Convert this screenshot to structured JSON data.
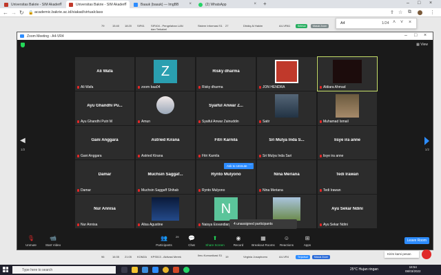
{
  "browser": {
    "tabs": [
      {
        "title": "Universitas Bakrie - SIM Akadem",
        "active": false,
        "color": "#c0392b"
      },
      {
        "title": "Universitas Bakrie - SIM Akadem",
        "active": true,
        "color": "#c0392b"
      },
      {
        "title": "Baauk (baauk) — ImgBB",
        "active": false,
        "color": "#2d8cff"
      },
      {
        "title": "(2) WhatsApp",
        "active": false,
        "color": "#25d366"
      }
    ],
    "url": "academic.bakrie.ac.id/siakad/virtualclass",
    "find": {
      "query": "A4",
      "count": "1/24"
    }
  },
  "bg_table": {
    "top_row": [
      "79",
      "15:40",
      "18:20",
      "SIF61",
      "SIF404 - Pengelahan LAN dan Terkabel",
      "Sistem Informasi S1",
      "27",
      "Dhidiq Al Hakim",
      "A4-VR61",
      "Selesai",
      "Masuk Zoom"
    ],
    "bottom_row": [
      "96",
      "16:35",
      "21:05",
      "KOM2A",
      "KPS513 - Aktivasi Merek",
      "Ilmu Komunikasi S1",
      "19",
      "Virginia Josaphoero",
      "A4-VR4",
      "Terjadwal",
      "Masuk Zoom"
    ]
  },
  "zoom": {
    "window_title": "Zoom Meeting - A4-VR4",
    "view_label": "View",
    "page_left": "1/2",
    "page_right": "1/2",
    "ask_unmute": "Ask to Unmute",
    "unassigned": "4 unassigned participants",
    "participant_count": "29",
    "tiles": [
      {
        "big": "Ali Wafa",
        "label": "Ali Wafa"
      },
      {
        "big": "",
        "label": "zoom baa04",
        "avatar": "Z"
      },
      {
        "big": "Risky dharma",
        "label": "Risky dharma"
      },
      {
        "big": "",
        "label": "JON HENDRA",
        "avatar": "img-red"
      },
      {
        "big": "",
        "label": "Aldiara Ahmad",
        "avatar": "dark"
      },
      {
        "big": "Ayu Ghandhi Pu...",
        "label": "Ayu Ghandhi Putri M"
      },
      {
        "big": "",
        "label": "Amun",
        "avatar": "img-girl"
      },
      {
        "big": "Syaiful Anwar Z...",
        "label": "Syaiful Anwar Zainuddin"
      },
      {
        "big": "",
        "label": "Satir",
        "avatar": "img-man"
      },
      {
        "big": "",
        "label": "Muhamad Ismail",
        "avatar": "img-two"
      },
      {
        "big": "Gani Anggara",
        "label": "Gani Anggara"
      },
      {
        "big": "Astried Kirana",
        "label": "Astried Kirana"
      },
      {
        "big": "Fitri Karnila",
        "label": "Fitri Karnila"
      },
      {
        "big": "Sri Mulya Inda S...",
        "label": "Sri Mulya Inda Sari"
      },
      {
        "big": "lisye ira anne",
        "label": "lisye ira anne"
      },
      {
        "big": "Damar",
        "label": "Damar"
      },
      {
        "big": "Muchsin Saggaf...",
        "label": "Muchsin Saggaff Shihab"
      },
      {
        "big": "Rynto Mulyono",
        "label": "Rynto Mulyono"
      },
      {
        "big": "Nina Meriana",
        "label": "Nina Meriana"
      },
      {
        "big": "Tedi Irawan",
        "label": "Tedi Irawan"
      },
      {
        "big": "Nur Annisa",
        "label": "Nur Annisa"
      },
      {
        "big": "",
        "label": "Alisa Agustine",
        "avatar": "img-city"
      },
      {
        "big": "",
        "label": "Naisya Esvandiary",
        "avatar": "N"
      },
      {
        "big": "",
        "label": "",
        "avatar": "img-house"
      },
      {
        "big": "Ayu Sekar Ndini",
        "label": "Ayu Sekar Ndini"
      }
    ],
    "toolbar": {
      "unmute": "Unmute",
      "start_video": "Start Video",
      "participants": "Participants",
      "chat": "Chat",
      "share": "Share Screen",
      "record": "Record",
      "breakout": "Breakout Rooms",
      "reactions": "Reactions",
      "apps": "Apps",
      "leave": "Leave Room"
    }
  },
  "toast": "Kirim kami pesan",
  "taskbar": {
    "search_placeholder": "Type here to search",
    "weather": "25°C  Hujan ringan",
    "time": "18:54",
    "date": "08/03/2022"
  }
}
